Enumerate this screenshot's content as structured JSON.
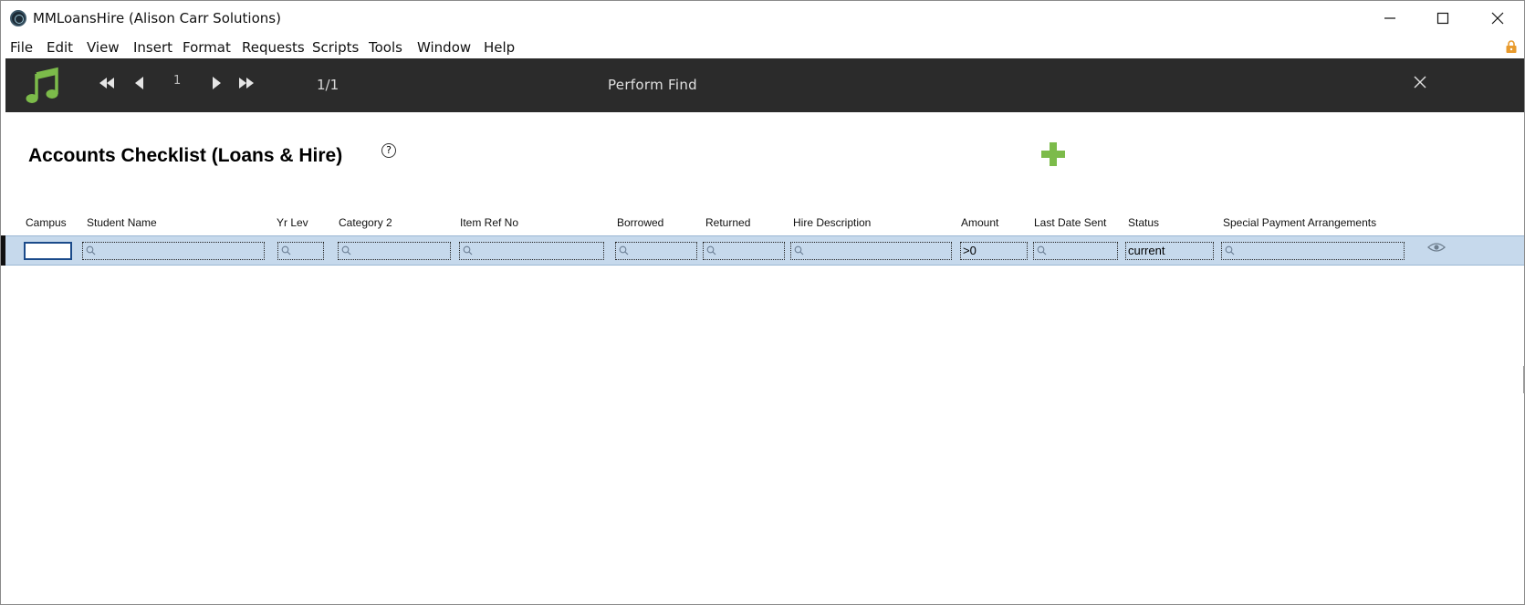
{
  "window": {
    "title": "MMLoansHire (Alison Carr Solutions)"
  },
  "menu": [
    "File",
    "Edit",
    "View",
    "Insert",
    "Format",
    "Requests",
    "Scripts",
    "Tools",
    "Window",
    "Help"
  ],
  "toolbar": {
    "record_number": "1",
    "record_count": "1/1",
    "mode_title": "Perform Find",
    "icons": [
      "music-note-icon",
      "first-record-icon",
      "previous-record-icon",
      "next-record-icon",
      "last-record-icon",
      "close-icon"
    ]
  },
  "layout": {
    "title": "Accounts Checklist (Loans & Hire)",
    "help_symbol": "?",
    "accent_color": "#7cbb4a"
  },
  "columns": [
    {
      "label": "Campus"
    },
    {
      "label": "Student Name"
    },
    {
      "label": "Yr Lev"
    },
    {
      "label": "Category 2"
    },
    {
      "label": "Item Ref No"
    },
    {
      "label": "Borrowed"
    },
    {
      "label": "Returned"
    },
    {
      "label": "Hire Description"
    },
    {
      "label": "Amount"
    },
    {
      "label": "Last Date Sent"
    },
    {
      "label": "Status"
    },
    {
      "label": "Special Payment Arrangements"
    }
  ],
  "find_request": {
    "campus": "",
    "student_name": "",
    "yr_lev": "",
    "category_2": "",
    "item_ref_no": "",
    "borrowed": "",
    "returned": "",
    "hire_description": "",
    "amount": ">0",
    "last_date_sent": "",
    "status": "current",
    "special_payment_arrangements": ""
  }
}
